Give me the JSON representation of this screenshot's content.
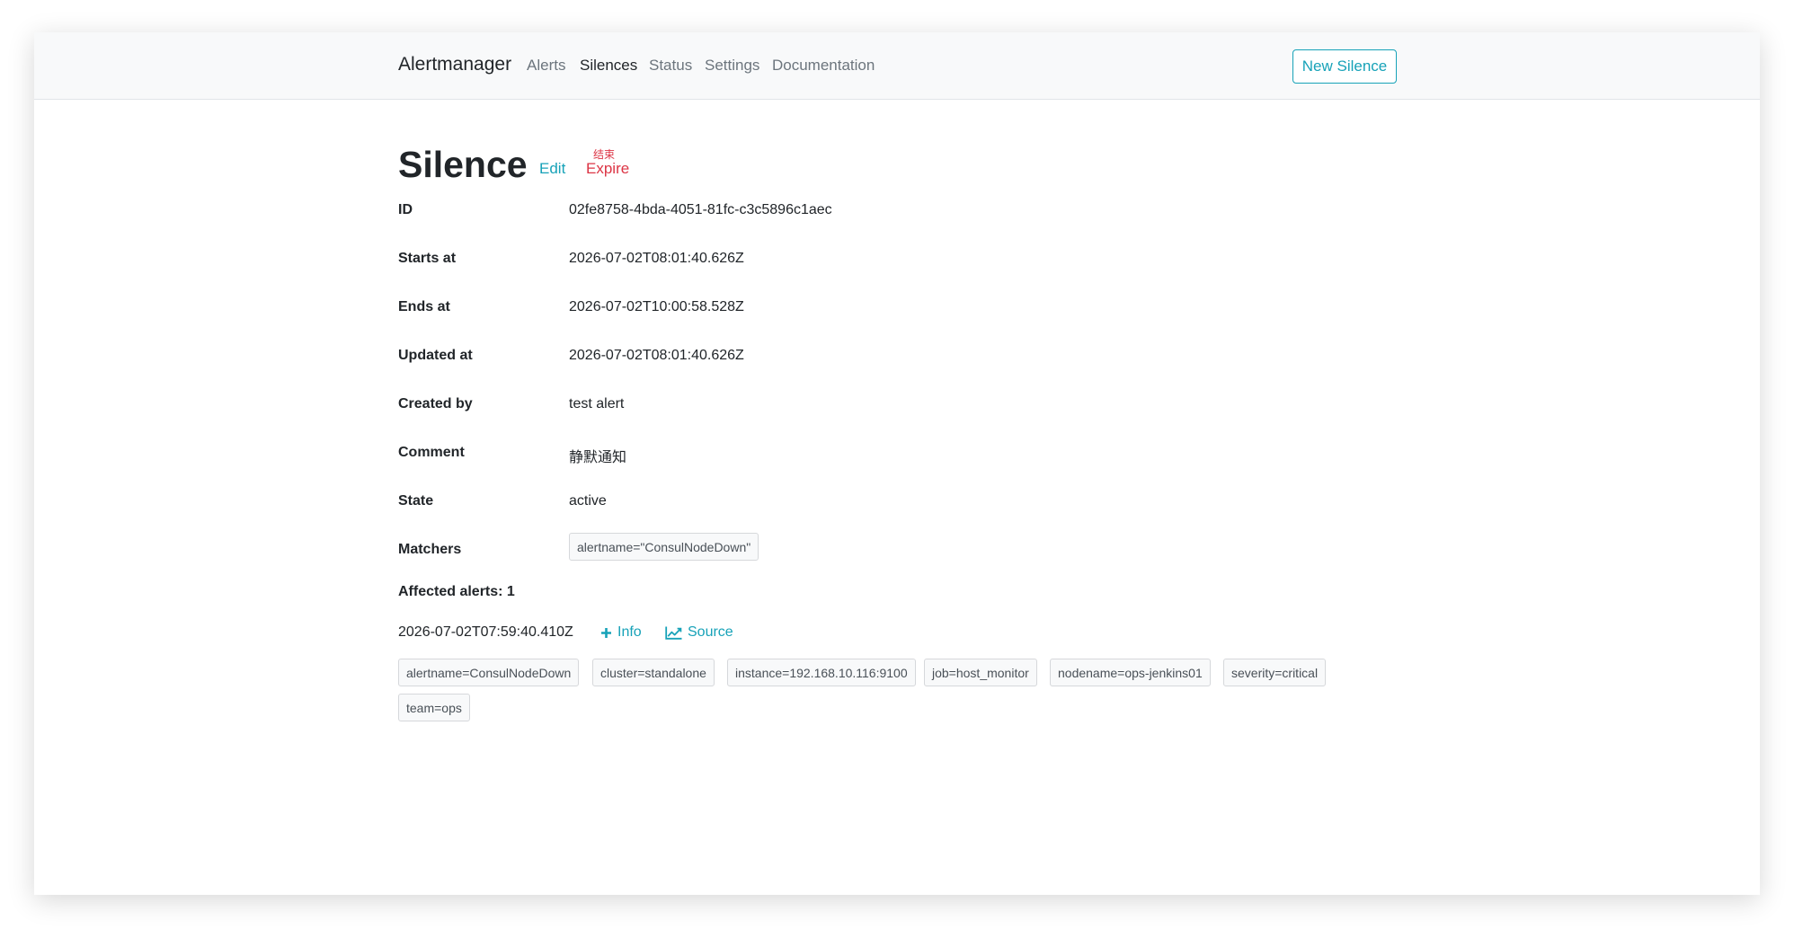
{
  "nav": {
    "brand": "Alertmanager",
    "links": [
      "Alerts",
      "Silences",
      "Status",
      "Settings",
      "Documentation"
    ],
    "active": "Silences",
    "new_silence_label": "New Silence"
  },
  "silence": {
    "title": "Silence",
    "edit_label": "Edit",
    "expire_note": "结束",
    "expire_label": "Expire",
    "rows": [
      {
        "label": "ID",
        "value": "02fe8758-4bda-4051-81fc-c3c5896c1aec"
      },
      {
        "label": "Starts at",
        "value": "2026-07-02T08:01:40.626Z"
      },
      {
        "label": "Ends at",
        "value": "2026-07-02T10:00:58.528Z"
      },
      {
        "label": "Updated at",
        "value": "2026-07-02T08:01:40.626Z"
      },
      {
        "label": "Created by",
        "value": "test alert"
      },
      {
        "label": "Comment",
        "value": "静默通知"
      },
      {
        "label": "State",
        "value": "active"
      }
    ],
    "matchers_label": "Matchers",
    "matchers": [
      "alertname=\"ConsulNodeDown\""
    ]
  },
  "affected": {
    "heading": "Affected alerts: 1",
    "alerts": [
      {
        "time": "2026-07-02T07:59:40.410Z",
        "info_label": "Info",
        "source_label": "Source",
        "labels": [
          "alertname=ConsulNodeDown",
          "cluster=standalone",
          "instance=192.168.10.116:9100",
          "job=host_monitor",
          "nodename=ops-jenkins01",
          "severity=critical",
          "team=ops"
        ]
      }
    ]
  },
  "colors": {
    "accent": "#17a2b8",
    "danger": "#dc3545",
    "navbar_bg": "#f8f9fa"
  }
}
